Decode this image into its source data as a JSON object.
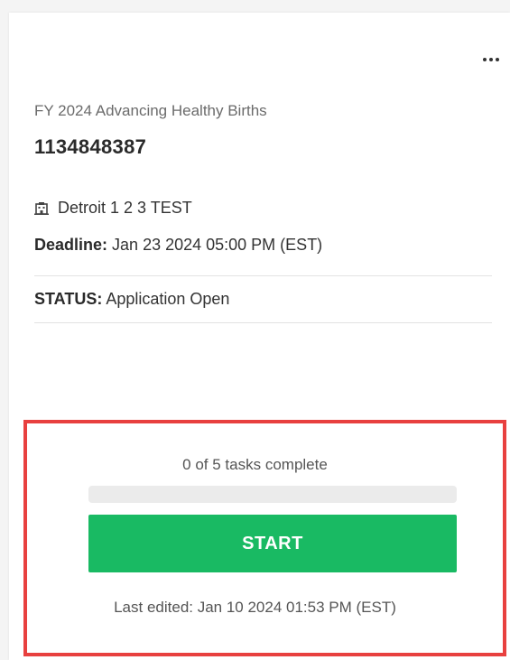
{
  "card": {
    "program_name": "FY 2024 Advancing Healthy Births",
    "application_id": "1134848387",
    "organization": "Detroit 1 2 3 TEST",
    "deadline_label": "Deadline:",
    "deadline_value": "Jan 23 2024 05:00 PM (EST)",
    "status_label": "STATUS:",
    "status_value": "Application Open",
    "more_icon": "more-horizontal-icon",
    "org_icon": "building-icon"
  },
  "tasks": {
    "summary": "0 of 5 tasks complete",
    "completed": 0,
    "total": 5,
    "progress_fraction": 0
  },
  "actions": {
    "start_label": "START",
    "start_color": "#19ba63"
  },
  "footer": {
    "last_edited": "Last edited: Jan 10 2024 01:53 PM (EST)"
  },
  "colors": {
    "highlight_border": "#e8403f",
    "progress_track": "#ebebeb"
  }
}
